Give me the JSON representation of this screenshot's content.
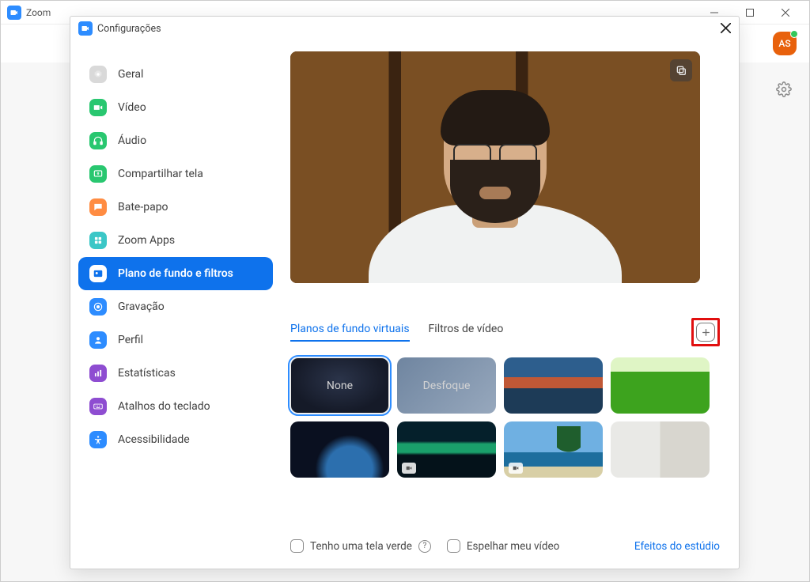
{
  "app": {
    "title": "Zoom",
    "avatar_initials": "AS"
  },
  "settings": {
    "title": "Configurações",
    "sidebar": [
      {
        "key": "geral",
        "label": "Geral"
      },
      {
        "key": "video",
        "label": "Vídeo"
      },
      {
        "key": "audio",
        "label": "Áudio"
      },
      {
        "key": "share",
        "label": "Compartilhar tela"
      },
      {
        "key": "chat",
        "label": "Bate-papo"
      },
      {
        "key": "apps",
        "label": "Zoom Apps"
      },
      {
        "key": "bg",
        "label": "Plano de fundo e filtros"
      },
      {
        "key": "rec",
        "label": "Gravação"
      },
      {
        "key": "profile",
        "label": "Perfil"
      },
      {
        "key": "stats",
        "label": "Estatísticas"
      },
      {
        "key": "keys",
        "label": "Atalhos do teclado"
      },
      {
        "key": "access",
        "label": "Acessibilidade"
      }
    ],
    "tabs": {
      "virtual_bg": "Planos de fundo virtuais",
      "video_filters": "Filtros de vídeo"
    },
    "tiles": {
      "none": "None",
      "blur": "Desfoque"
    },
    "bottom": {
      "green_screen": "Tenho uma tela verde",
      "mirror": "Espelhar meu vídeo",
      "studio": "Efeitos do estúdio"
    }
  }
}
